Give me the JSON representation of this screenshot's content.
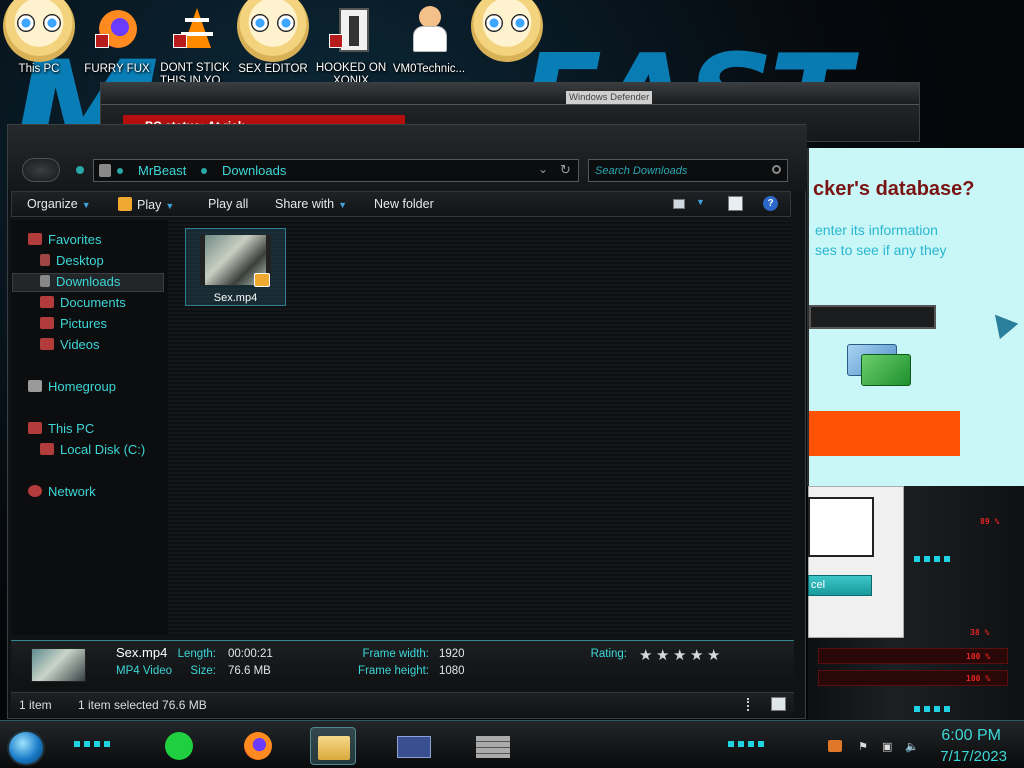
{
  "desktop": {
    "icons": [
      {
        "label": "This PC"
      },
      {
        "label": "FURRY FUX"
      },
      {
        "label": "DONT STICK THIS IN YO..."
      },
      {
        "label": "SEX EDITOR"
      },
      {
        "label": "HOOKED ON XONIX"
      },
      {
        "label": "VM0Technic..."
      }
    ]
  },
  "back_window": {
    "title": "Windows Defender",
    "status": "PC status: At risk"
  },
  "popup": {
    "heading": "cker's database?",
    "line1": "enter its information",
    "line2": "ses to see if any they",
    "cancel_label": "cel"
  },
  "hud": {
    "readouts": [
      "89 %",
      "38 %",
      "100 %",
      "100 %"
    ]
  },
  "explorer": {
    "breadcrumb": [
      "MrBeast",
      "Downloads"
    ],
    "search_placeholder": "Search Downloads",
    "toolbar": {
      "organize": "Organize",
      "play": "Play",
      "play_all": "Play all",
      "share_with": "Share with",
      "new_folder": "New folder"
    },
    "nav": {
      "favorites": "Favorites",
      "desktop": "Desktop",
      "downloads": "Downloads",
      "documents": "Documents",
      "pictures": "Pictures",
      "videos": "Videos",
      "homegroup": "Homegroup",
      "this_pc": "This PC",
      "local_disk": "Local Disk (C:)",
      "network": "Network"
    },
    "file": {
      "name": "Sex.mp4"
    },
    "details": {
      "name": "Sex.mp4",
      "type": "MP4 Video",
      "length_label": "Length:",
      "length": "00:00:21",
      "size_label": "Size:",
      "size": "76.6 MB",
      "frame_width_label": "Frame width:",
      "frame_width": "1920",
      "frame_height_label": "Frame height:",
      "frame_height": "1080",
      "rating_label": "Rating:",
      "rating_stars": 0
    },
    "status": {
      "count": "1 item",
      "selected": "1 item selected  76.6 MB"
    }
  },
  "taskbar": {
    "time": "6:00 PM",
    "date": "7/17/2023"
  },
  "colors": {
    "accent": "#3cd7d7",
    "alert_red": "#b40e0e",
    "popup_bg": "#c9f7f7",
    "popup_button": "#ff5205"
  }
}
